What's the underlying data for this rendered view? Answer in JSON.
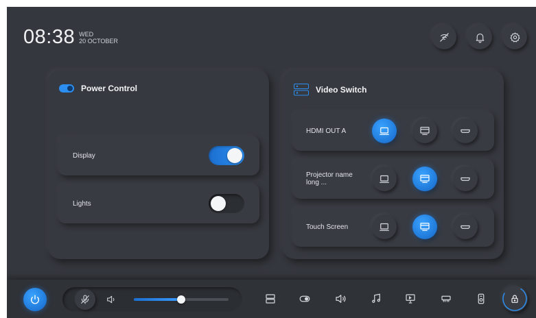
{
  "header": {
    "time": "08:38",
    "day": "WED",
    "date": "20 OCTOBER",
    "icons": [
      "no-wifi-icon",
      "bell-icon",
      "gear-icon"
    ]
  },
  "power_control": {
    "title": "Power Control",
    "items": [
      {
        "label": "Display",
        "on": true
      },
      {
        "label": "Lights",
        "on": false
      }
    ]
  },
  "video_switch": {
    "title": "Video Switch",
    "outputs": [
      {
        "label": "HDMI OUT A",
        "active_source": "laptop"
      },
      {
        "label": "Projector name long ...",
        "active_source": "projector"
      },
      {
        "label": "Touch Screen",
        "active_source": "projector"
      }
    ],
    "sources": [
      "laptop",
      "projector",
      "hdmi"
    ]
  },
  "bottom_bar": {
    "volume_level_percent": 50,
    "icons": [
      "video-switch-icon",
      "toggle-icon",
      "speaker-icon",
      "music-note-icon",
      "presentation-icon",
      "projector-icon",
      "thermostat-icon",
      "lock-icon"
    ]
  },
  "colors": {
    "background": "#34373d",
    "accent": "#2b8ef0"
  }
}
